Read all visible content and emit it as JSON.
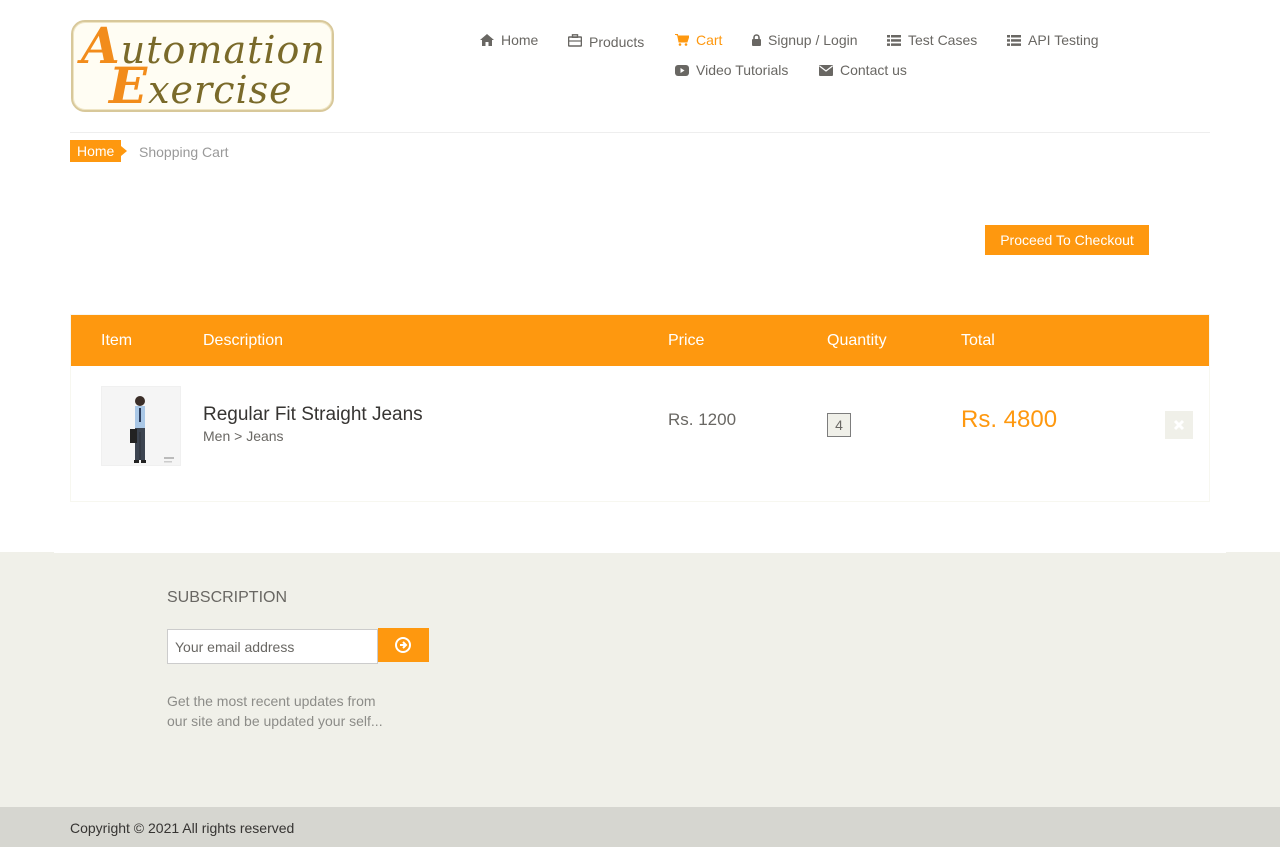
{
  "header": {
    "logo": {
      "word1": "Automation",
      "word2": "Exercise"
    },
    "nav": [
      {
        "label": "Home",
        "icon": "home-icon"
      },
      {
        "label": "Products",
        "icon": "briefcase-icon"
      },
      {
        "label": "Cart",
        "icon": "shopping-cart-icon",
        "active": true
      },
      {
        "label": "Signup / Login",
        "icon": "lock-icon"
      },
      {
        "label": "Test Cases",
        "icon": "list-icon"
      },
      {
        "label": "API Testing",
        "icon": "list-icon"
      },
      {
        "label": "Video Tutorials",
        "icon": "youtube-play-icon"
      },
      {
        "label": "Contact us",
        "icon": "envelope-icon"
      }
    ]
  },
  "breadcrumb": {
    "home": "Home",
    "current": "Shopping Cart"
  },
  "checkout_button": "Proceed To Checkout",
  "cart": {
    "columns": [
      "Item",
      "Description",
      "Price",
      "Quantity",
      "Total"
    ],
    "items": [
      {
        "name": "Regular Fit Straight Jeans",
        "category": "Men > Jeans",
        "price": "Rs. 1200",
        "quantity": "4",
        "total": "Rs. 4800"
      }
    ]
  },
  "footer": {
    "subscription_title": "SUBSCRIPTION",
    "email_placeholder": "Your email address",
    "subscription_text": "Get the most recent updates from our site and be updated your self...",
    "copyright": "Copyright © 2021 All rights reserved"
  },
  "colors": {
    "accent": "#fe980f",
    "text": "#696763",
    "footer_bg": "#f0f0e9"
  }
}
